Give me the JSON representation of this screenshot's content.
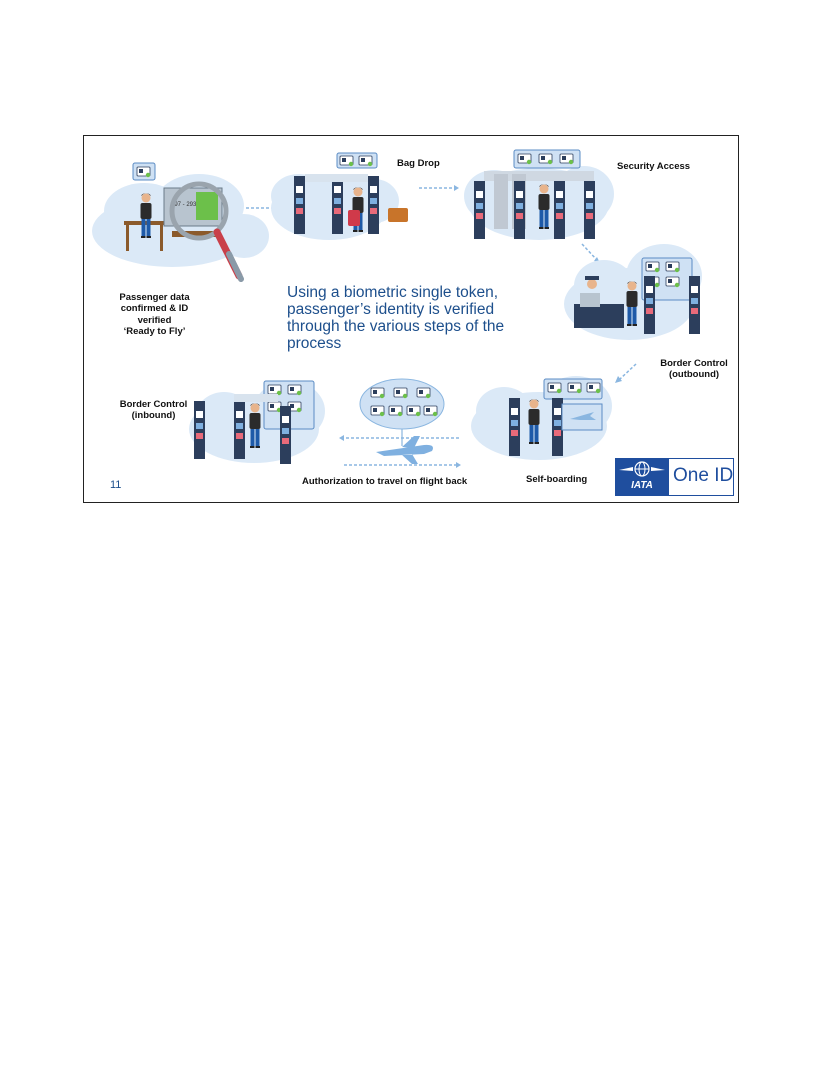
{
  "slide": {
    "headline": "Using a biometric single token, passenger’s identity is verified through the various steps of the process",
    "page_number": "11",
    "steps": {
      "passenger_data": [
        "Passenger data",
        "confirmed & ID",
        "verified",
        "‘Ready to Fly’"
      ],
      "bag_drop": "Bag Drop",
      "security_access": "Security Access",
      "border_control_outbound": [
        "Border Control",
        "(outbound)"
      ],
      "self_boarding": "Self-boarding",
      "border_control_inbound": [
        "Border Control",
        "(inbound)"
      ],
      "authorization": "Authorization to travel on flight back"
    },
    "kiosk_text": "397 - 293",
    "logo": {
      "org": "IATA",
      "product": "One ID"
    }
  },
  "colors": {
    "headline": "#1d4f8c",
    "cloud": "#dbe9f7",
    "gate": "#2c3e5c",
    "accent": "#1f4e9e",
    "arrow": "#8ab6e0"
  },
  "icons": [
    "cloud-icon",
    "gate-icon",
    "passenger-icon",
    "suitcase-icon",
    "magnifier-icon",
    "airplane-icon",
    "token-panel-icon",
    "iata-globe-icon"
  ]
}
